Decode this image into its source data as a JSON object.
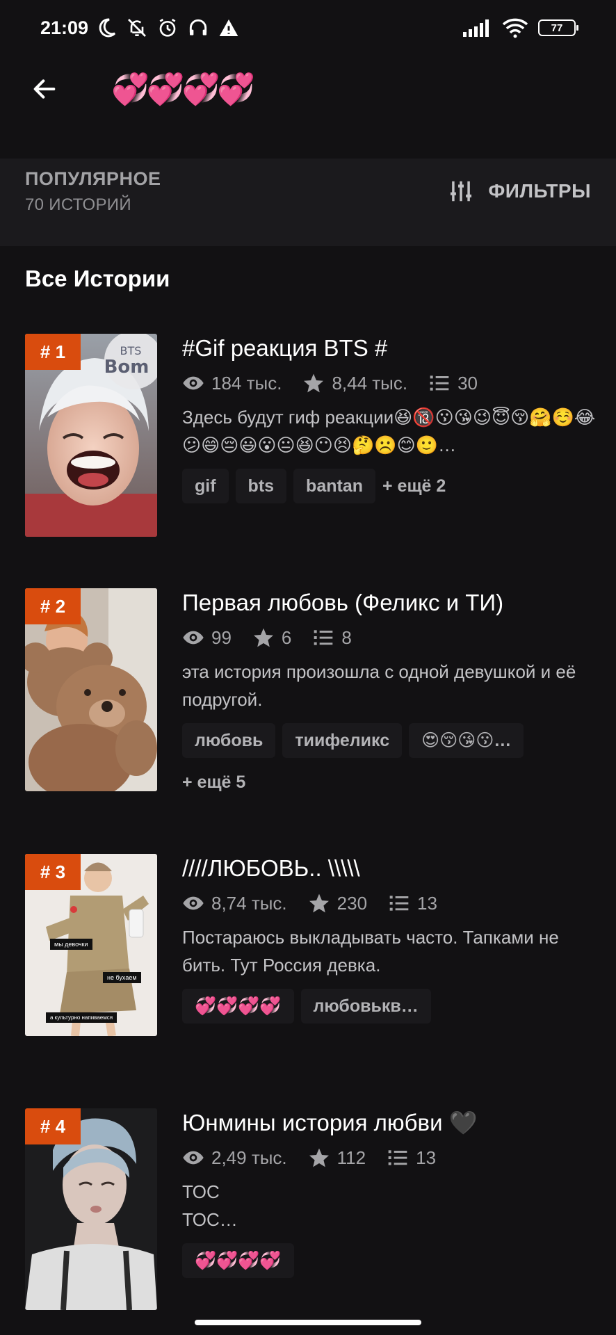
{
  "status_bar": {
    "time": "21:09",
    "battery": "77",
    "icons_left": [
      "moon-icon",
      "bell-off-icon",
      "alarm-icon",
      "headphones-icon",
      "warning-icon"
    ],
    "icons_right": [
      "signal-icon",
      "wifi-icon",
      "battery-icon"
    ]
  },
  "app_bar": {
    "title": "💞💞💞💞"
  },
  "filter_bar": {
    "sort_label": "ПОПУЛЯРНОЕ",
    "count_label": "70 ИСТОРИЙ",
    "filters_label": "ФИЛЬТРЫ"
  },
  "section_title": "Все Истории",
  "stories": [
    {
      "rank": "# 1",
      "title": "#Gif реакция BTS #",
      "views": "184 тыс.",
      "votes": "8,44 тыс.",
      "parts": "30",
      "description": "Здесь будут гиф реакции😆🔞😗😘😉😇😚🤗☺️😂😕😄😔😃😮😐😆😶😣🤔☹️😊🙂…",
      "tags": [
        "gif",
        "bts",
        "bantan"
      ],
      "more": "+ ещё 2",
      "cover_text": "BTS Bom"
    },
    {
      "rank": "# 2",
      "title": "Первая любовь (Феликс и ТИ)",
      "views": "99",
      "votes": "6",
      "parts": "8",
      "description": "эта история произошла с одной девушкой и её подругой.",
      "tags": [
        "любовь",
        "тиифеликс",
        "😍😚😘😗…"
      ],
      "more": "+ ещё 5"
    },
    {
      "rank": "# 3",
      "title": "////ЛЮБОВЬ.. \\\\\\\\\\",
      "views": "8,74 тыс.",
      "votes": "230",
      "parts": "13",
      "description": "Постараюсь выкладывать часто. Тапками не бить. Тут Россия девка.",
      "tags": [
        "💞💞💞💞",
        "любовькв…"
      ],
      "cover_lines": [
        "мы девочки",
        "не бухаем",
        "а культурно напиваемся"
      ]
    },
    {
      "rank": "# 4",
      "title": "Юнмины история любви 🖤",
      "views": "2,49 тыс.",
      "votes": "112",
      "parts": "13",
      "description_lines": [
        "ТОС",
        "ТОС…"
      ],
      "tags": [
        "💞💞💞💞"
      ]
    }
  ]
}
